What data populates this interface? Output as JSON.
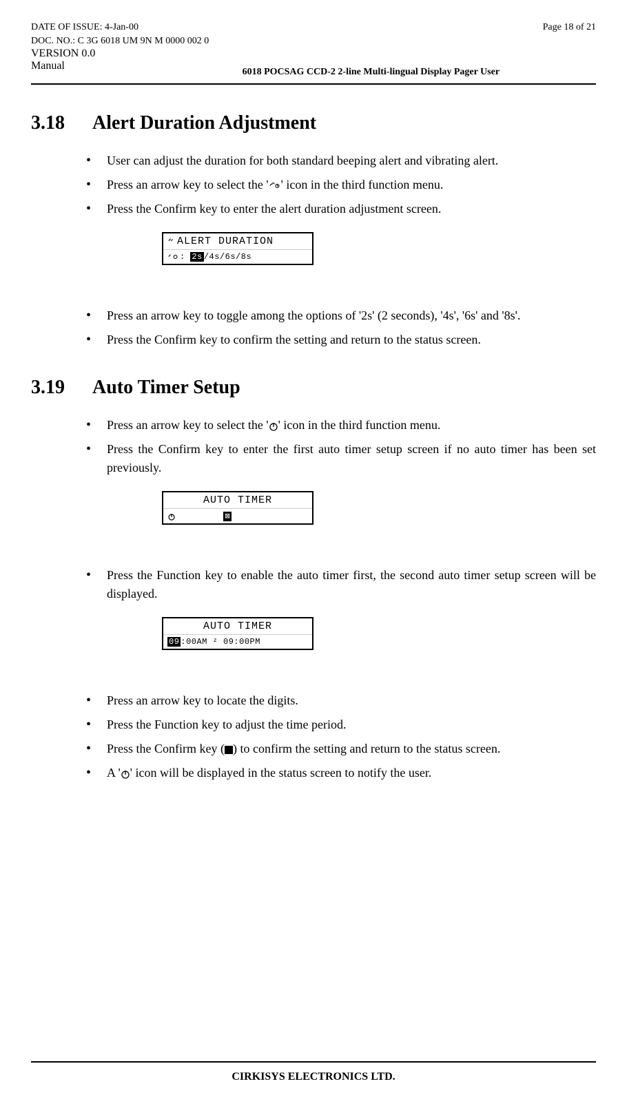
{
  "header": {
    "date_label": "DATE OF ISSUE: 4-Jan-00",
    "doc_label": "DOC. NO.: C 3G 6018 UM 9N M 0000 002 0",
    "version_label": "VERSION 0.0",
    "manual_label": "Manual",
    "page_label": "Page 18 of 21",
    "title": "6018 POCSAG CCD-2 2-line Multi-lingual Display Pager User"
  },
  "section1": {
    "number": "3.18",
    "title": "Alert Duration Adjustment",
    "items": [
      "User can adjust the duration for both standard beeping alert and vibrating alert.",
      "Press an arrow key to select the '___ICON1___' icon in the third function menu.",
      "Press the Confirm key to enter the alert duration adjustment screen."
    ],
    "lcd": {
      "line1": "ALERT DURATION",
      "line2_prefix": "⦾⊙:",
      "line2_sel": "2s",
      "line2_rest": "/4s/6s/8s"
    },
    "items2": [
      "Press an arrow key to toggle among the options of '2s' (2 seconds), '4s', '6s' and '8s'.",
      "Press the Confirm key to confirm the setting and return to the status screen."
    ]
  },
  "section2": {
    "number": "3.19",
    "title": "Auto Timer Setup",
    "items": [
      "Press an arrow key to select the '___ICON2___' icon in the third function menu.",
      "Press the Confirm key to enter the first auto timer setup screen if no auto timer has been set previously."
    ],
    "lcd1": {
      "line1": "AUTO TIMER",
      "line2": "⏻        ⊠"
    },
    "items2": [
      "Press the Function key to enable the auto timer first, the second auto timer setup screen will be displayed."
    ],
    "lcd2": {
      "line1": "AUTO TIMER",
      "line2_sel": "09",
      "line2_rest": ":00AM  ᶻ 09:00PM"
    },
    "items3": [
      "Press an arrow key to locate the digits.",
      "Press the Function key to adjust the time period.",
      "Press the Confirm key (___ICON3___) to confirm the setting and return to the status screen.",
      "A '___ICON4___' icon will be displayed in the status screen to notify the user."
    ]
  },
  "footer": "CIRKISYS ELECTRONICS LTD."
}
